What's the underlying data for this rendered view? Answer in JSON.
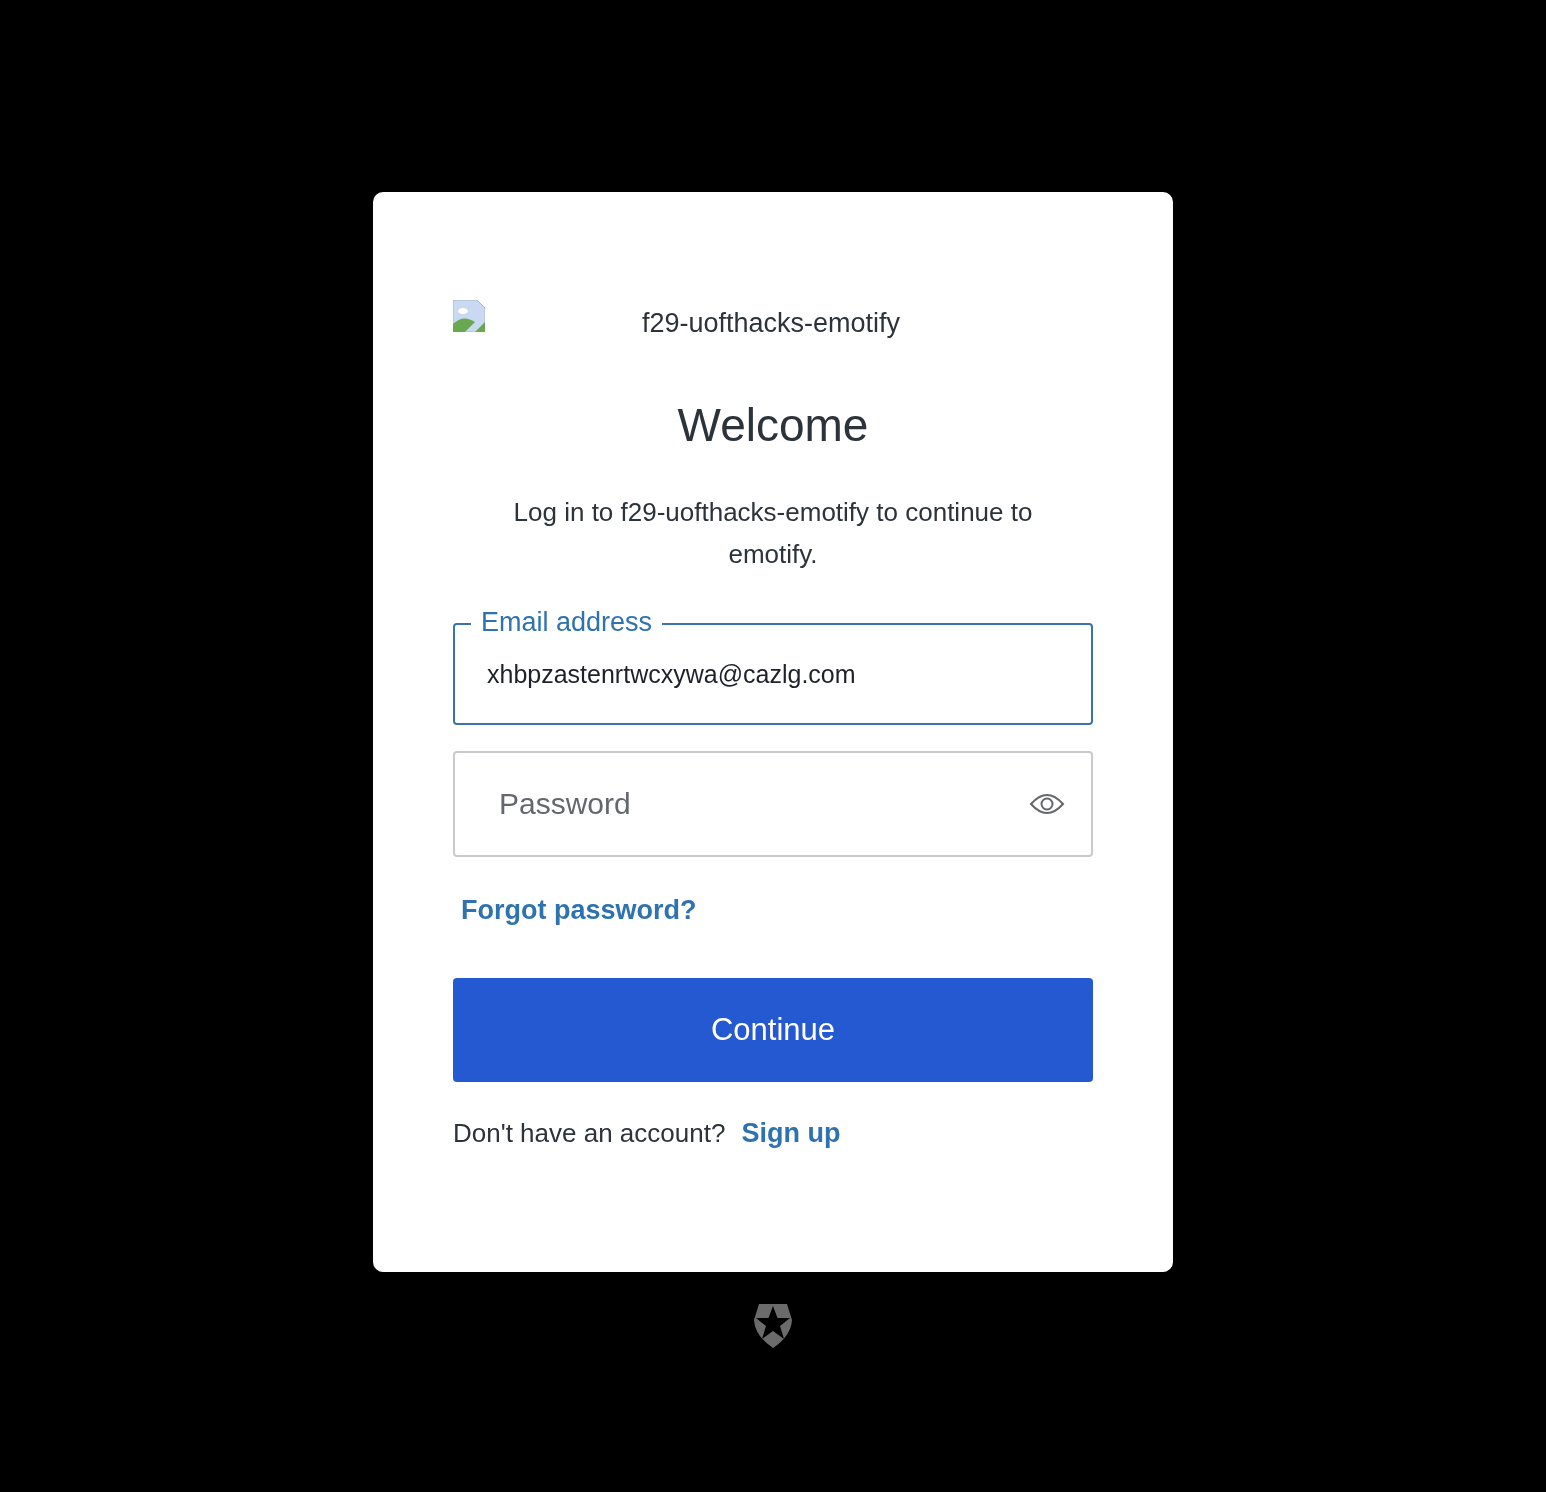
{
  "app_name": "f29-uofthacks-emotify",
  "heading": "Welcome",
  "description": "Log in to f29-uofthacks-emotify to continue to emotify.",
  "email_field": {
    "label": "Email address",
    "value": "xhbpzastenrtwcxywa@cazlg.com"
  },
  "password_field": {
    "placeholder": "Password"
  },
  "forgot_link": "Forgot password?",
  "continue_button": "Continue",
  "signup_prompt": "Don't have an account?",
  "signup_link": "Sign up"
}
